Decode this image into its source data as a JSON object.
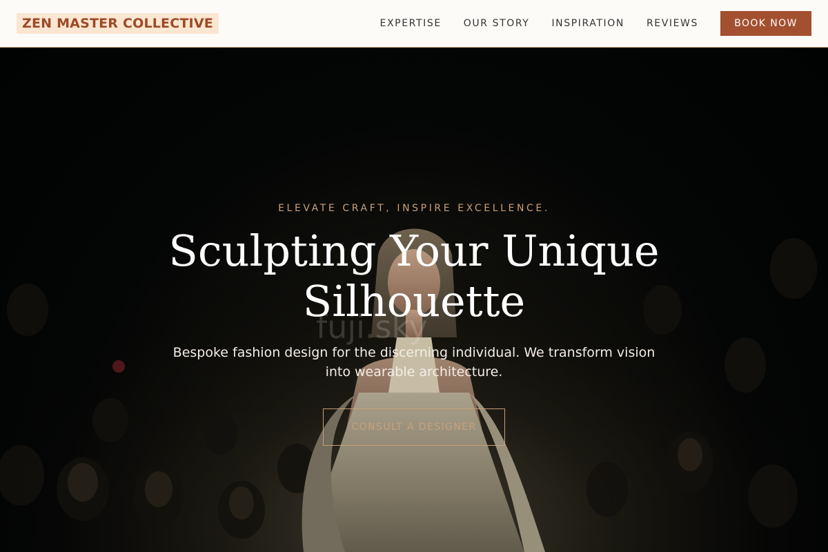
{
  "brand": {
    "name": "ZEN MASTER COLLECTIVE"
  },
  "nav": {
    "items": [
      {
        "label": "EXPERTISE"
      },
      {
        "label": "OUR STORY"
      },
      {
        "label": "INSPIRATION"
      },
      {
        "label": "REVIEWS"
      }
    ],
    "cta_label": "BOOK NOW"
  },
  "hero": {
    "tagline": "ELEVATE CRAFT, INSPIRE EXCELLENCE.",
    "title": "Sculpting Your Unique Silhouette",
    "description": "Bespoke fashion design for the discerning individual. We transform vision into wearable architecture.",
    "cta_label": "CONSULT A DESIGNER",
    "watermark": "fuji.sky"
  },
  "colors": {
    "accent": "#a35030",
    "gold": "#c9a07a",
    "logo_bg": "#fbe6d2",
    "logo_text": "#9c4a26",
    "nav_bg": "#fdfbf8",
    "hero_bg": "#050606"
  }
}
